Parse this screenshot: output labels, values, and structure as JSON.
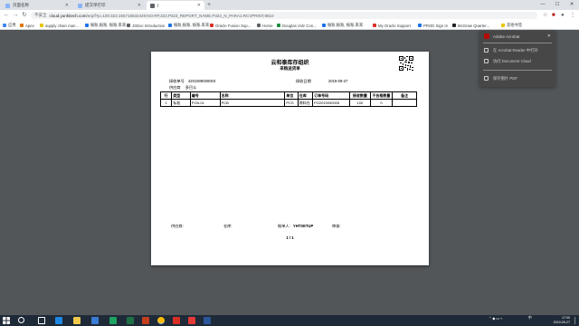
{
  "browser": {
    "tabs": [
      {
        "label": "页面名称"
      },
      {
        "label": "提交单打印"
      },
      {
        "label": "f"
      }
    ],
    "new_tab_symbol": "+",
    "window_controls": {
      "minimize": "—",
      "maximize": "☐",
      "close": "✕"
    },
    "toolbar": {
      "back": "←",
      "forward": "→",
      "reload": "↻"
    },
    "address": {
      "secure_label": "不安全",
      "host": "cloud.yunhitech.com",
      "path": "/erp/f?p=100:323:155716632449:NO:RP,323,P323_REPORT_NAME,P323_N_PARA1:RCVPRINT,9810"
    },
    "bookmarks": [
      {
        "label": "应用",
        "color": "#4285f4"
      },
      {
        "label": "Apex",
        "color": "#e37400"
      },
      {
        "label": "supply chain man...",
        "color": "#e8c300"
      },
      {
        "label": "报账,报账, 报账.来来",
        "color": "#1a73e8"
      },
      {
        "label": "JSDoc Introduction",
        "color": "#5f6368"
      },
      {
        "label": "报账,报账, 报账.来来",
        "color": "#1a73e8"
      },
      {
        "label": "Oracle Fusion Sup...",
        "color": "#d93025"
      },
      {
        "label": "Home",
        "color": "#5f6368"
      },
      {
        "label": "Douglas Volz Con...",
        "color": "#1e8e3e"
      },
      {
        "label": "报账,报账, 报账.来来",
        "color": "#1a73e8"
      },
      {
        "label": "My Oracle Support",
        "color": "#d93025"
      },
      {
        "label": "PROD Sign In",
        "color": "#1a73e8"
      },
      {
        "label": "McGraw Quarter...",
        "color": "#202124"
      },
      {
        "label": "其他书签",
        "color": "#e8c300"
      }
    ]
  },
  "document": {
    "title": "云和泰库存组织",
    "subtitle": "采购送货单",
    "receipt_no_label": "接收单号",
    "receipt_no": "4201909000003",
    "receipt_date_label": "接收日期",
    "receipt_date": "2019-09-27",
    "supplier_label": "供应商",
    "supplier": "多巴斗",
    "columns": [
      "行",
      "类型",
      "编号",
      "名称",
      "单位",
      "仓库",
      "订单号码",
      "接收数量",
      "不合格数量",
      "备注"
    ],
    "rows": [
      [
        "1",
        "标准",
        "PCB-01",
        "PCB",
        "PCS",
        "原料仓",
        "PO2019090005",
        "100",
        "0",
        ""
      ]
    ],
    "footer": {
      "supplier_sign": "供应商:",
      "warehouse_sign": "仓库:",
      "creator_label": "制单人:",
      "creator": "YHTSETUP",
      "reviewer_sign": "审核:"
    },
    "page_number": "1 / 1"
  },
  "acrobat_menu": {
    "header": "Adobe Acrobat",
    "items": [
      {
        "label": "在 Acrobat Reader 中打开"
      },
      {
        "label": "访问 Document Cloud"
      },
      {
        "label": "保存图片 PDF"
      }
    ]
  },
  "taskbar": {
    "clock_time": "17:00",
    "clock_date": "2019-09-27",
    "lang": "中"
  }
}
